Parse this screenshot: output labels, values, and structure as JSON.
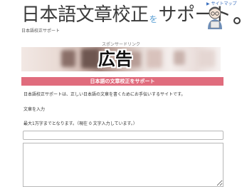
{
  "header": {
    "logo_part1": "日本語文章校正",
    "logo_connector": "を",
    "logo_part2": "サポート",
    "sitemap_link": "▶ サイトマップ",
    "subtitle": "日本語校正サポート"
  },
  "ad": {
    "label": "スポンサードリンク",
    "text": "広告"
  },
  "section": {
    "title": "日本語の文章校正をサポート"
  },
  "main": {
    "description": "日本語校正サポートは、正しい日本語の文章を書くためにお手伝いするサイトです。",
    "input_label": "文章を入力",
    "limit_note": "最大1万字までとなります。（現在 0 文字入力しています。）"
  },
  "colors": {
    "section_bar": "#e06c7d",
    "link": "#3a6fbf",
    "logo_accent": "#5a9fd4"
  }
}
